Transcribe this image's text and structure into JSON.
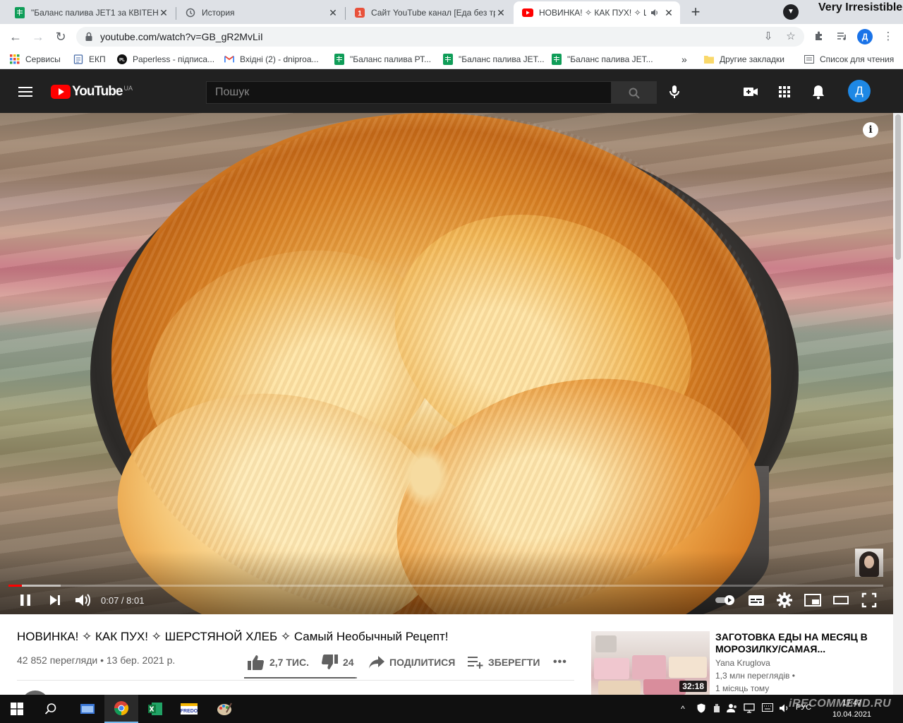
{
  "browser": {
    "tabs": [
      {
        "title": "\"Баланс палива JET1 за КВІТЕНЬ",
        "icon": "sheets-icon",
        "active": false
      },
      {
        "title": "История",
        "icon": "history-icon",
        "active": false
      },
      {
        "title": "Сайт YouTube канал [Еда без тр",
        "icon": "otzovik-icon",
        "active": false
      },
      {
        "title": "НОВИНКА! ✧ КАК ПУХ! ✧ Ш",
        "icon": "youtube-icon",
        "active": true
      }
    ],
    "corner_text": "Very Irresistible",
    "url": "youtube.com/watch?v=GB_gR2MvLiI",
    "profile_letter": "Д",
    "bookmarks": [
      {
        "label": "Сервисы",
        "icon": "apps-grid-icon"
      },
      {
        "label": "ЕКП",
        "icon": "doc-icon"
      },
      {
        "label": "Paperless - підписа...",
        "icon": "pl-icon"
      },
      {
        "label": "Вхідні (2) - dniproa...",
        "icon": "gmail-icon"
      },
      {
        "label": "\"Баланс палива РТ...",
        "icon": "sheets-icon"
      },
      {
        "label": "\"Баланс палива JET...",
        "icon": "sheets-icon"
      },
      {
        "label": "\"Баланс палива JET...",
        "icon": "sheets-icon"
      }
    ],
    "bookmarks_overflow": "»",
    "other_bookmarks": "Другие закладки",
    "reading_list": "Список для чтения"
  },
  "youtube": {
    "logo_text": "YouTube",
    "region": "UA",
    "search_placeholder": "Пошук",
    "user_letter": "Д"
  },
  "player": {
    "time": "0:07 / 8:01",
    "played_fraction": 0.015,
    "buffered_fraction": 0.06
  },
  "video": {
    "title": "НОВИНКА! ✧ КАК ПУХ! ✧ ШЕРСТЯНОЙ ХЛЕБ ✧ Самый Необычный Рецепт!",
    "meta": "42 852 перегляди • 13 бер. 2021 р.",
    "likes": "2,7 ТИС.",
    "dislikes": "24",
    "like_ratio": 0.99,
    "share_label": "ПОДІЛИТИСЯ",
    "save_label": "ЗБЕРЕГТИ",
    "more_label": "•••"
  },
  "recommendation": {
    "title": "ЗАГОТОВКА ЕДЫ НА МЕСЯЦ В МОРОЗИЛКУ/САМАЯ...",
    "channel": "Yana Kruglova",
    "views": "1,3 млн переглядів •",
    "age": "1 місяць тому",
    "duration": "32:18"
  },
  "taskbar": {
    "lang": "РУС",
    "time": "17:47",
    "date": "10.04.2021",
    "watermark": "iRECOMMEND.RU"
  }
}
